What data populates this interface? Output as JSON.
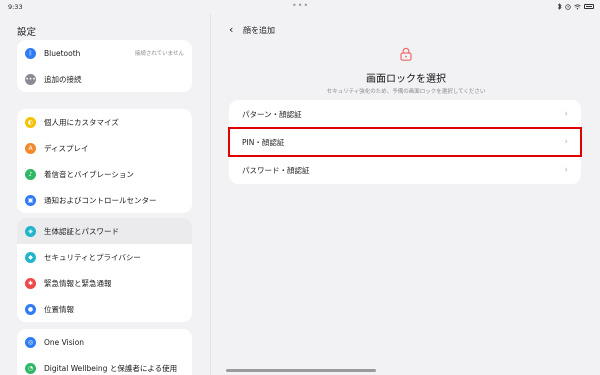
{
  "status": {
    "time": "9:33",
    "dots": "•••"
  },
  "sidebar": {
    "title": "設定",
    "cards": [
      [
        {
          "label": "Bluetooth",
          "icon": "bluetooth-icon",
          "color": "#2f7bf5",
          "glyph": "ᛒ",
          "trailing": "接続されていません"
        },
        {
          "label": "追加の接続",
          "icon": "more-icon",
          "color": "#8a8a94",
          "glyph": "•••"
        }
      ],
      [
        {
          "label": "個人用にカスタマイズ",
          "icon": "palette-icon",
          "color": "#f5c200",
          "glyph": "◐"
        },
        {
          "label": "ディスプレイ",
          "icon": "display-icon",
          "color": "#f28a2b",
          "glyph": "A"
        },
        {
          "label": "着信音とバイブレーション",
          "icon": "sound-icon",
          "color": "#2fb866",
          "glyph": "♪"
        },
        {
          "label": "通知およびコントロールセンター",
          "icon": "notification-icon",
          "color": "#2f7bf5",
          "glyph": "▣"
        }
      ],
      [
        {
          "label": "生体認証とパスワード",
          "icon": "biometric-icon",
          "color": "#22b5c9",
          "glyph": "◈",
          "selected": true
        },
        {
          "label": "セキュリティとプライバシー",
          "icon": "shield-icon",
          "color": "#22b5c9",
          "glyph": "◆"
        },
        {
          "label": "緊急情報と緊急通報",
          "icon": "emergency-icon",
          "color": "#f04848",
          "glyph": "✱"
        },
        {
          "label": "位置情報",
          "icon": "location-icon",
          "color": "#2f7bf5",
          "glyph": "●"
        }
      ],
      [
        {
          "label": "One Vision",
          "icon": "one-vision-icon",
          "color": "#2f7bf5",
          "glyph": "◎"
        },
        {
          "label": "Digital Wellbeing と保護者による使用",
          "icon": "wellbeing-icon",
          "color": "#2fb866",
          "glyph": "◔"
        }
      ]
    ]
  },
  "main": {
    "back_glyph": "‹",
    "title": "顔を追加",
    "heading": "画面ロックを選択",
    "subtitle": "セキュリティ強化のため、予備の画面ロックを選択してください",
    "chevron": "›",
    "options": [
      {
        "label": "パターン・顔認証"
      },
      {
        "label": "PIN・顔認証",
        "highlight": true
      },
      {
        "label": "パスワード・顔認証"
      }
    ]
  },
  "colors": {
    "accent_red": "#e00000",
    "lock_icon": "#f06b6b"
  }
}
